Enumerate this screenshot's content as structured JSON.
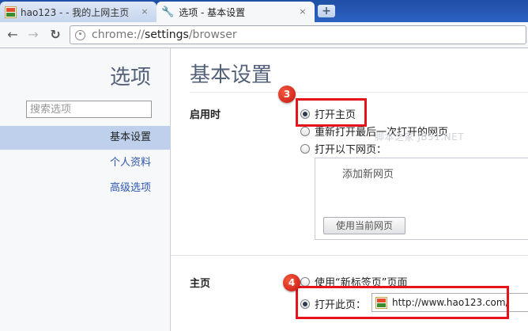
{
  "browser": {
    "tabs": [
      {
        "title": "hao123 - - 我的上网主页",
        "active": false,
        "icon": "hao123-favicon"
      },
      {
        "title": "选项 - 基本设置",
        "active": true,
        "icon": "wrench-icon"
      }
    ],
    "close_glyph": "×",
    "new_tab_glyph": "+",
    "url": {
      "scheme": "chrome://",
      "host": "settings",
      "path": "/browser"
    },
    "nav_glyphs": {
      "back": "←",
      "forward": "→",
      "reload": "↻"
    },
    "wrench_glyph": "🔧"
  },
  "sidebar": {
    "title": "选项",
    "search_placeholder": "搜索选项",
    "items": [
      {
        "label": "基本设置",
        "selected": true
      },
      {
        "label": "个人资料",
        "selected": false
      },
      {
        "label": "高级选项",
        "selected": false
      }
    ]
  },
  "main": {
    "title": "基本设置",
    "startup": {
      "label": "启用时",
      "options": [
        {
          "label": "打开主页",
          "checked": true
        },
        {
          "label": "重新打开最后一次打开的网页",
          "checked": false
        },
        {
          "label": "打开以下网页：",
          "checked": false
        }
      ],
      "add_page_label": "添加新网页",
      "use_current_button": "使用当前网页"
    },
    "homepage": {
      "label": "主页",
      "options": [
        {
          "label": "使用“新标签页”页面",
          "checked": false
        },
        {
          "label": "打开此页：",
          "checked": true
        }
      ],
      "url_value": "http://www.hao123.com/"
    }
  },
  "annotations": {
    "badge_1": "3",
    "badge_2": "4",
    "color": "#e5141b",
    "watermark": "脚本之家 JB51.NET"
  }
}
